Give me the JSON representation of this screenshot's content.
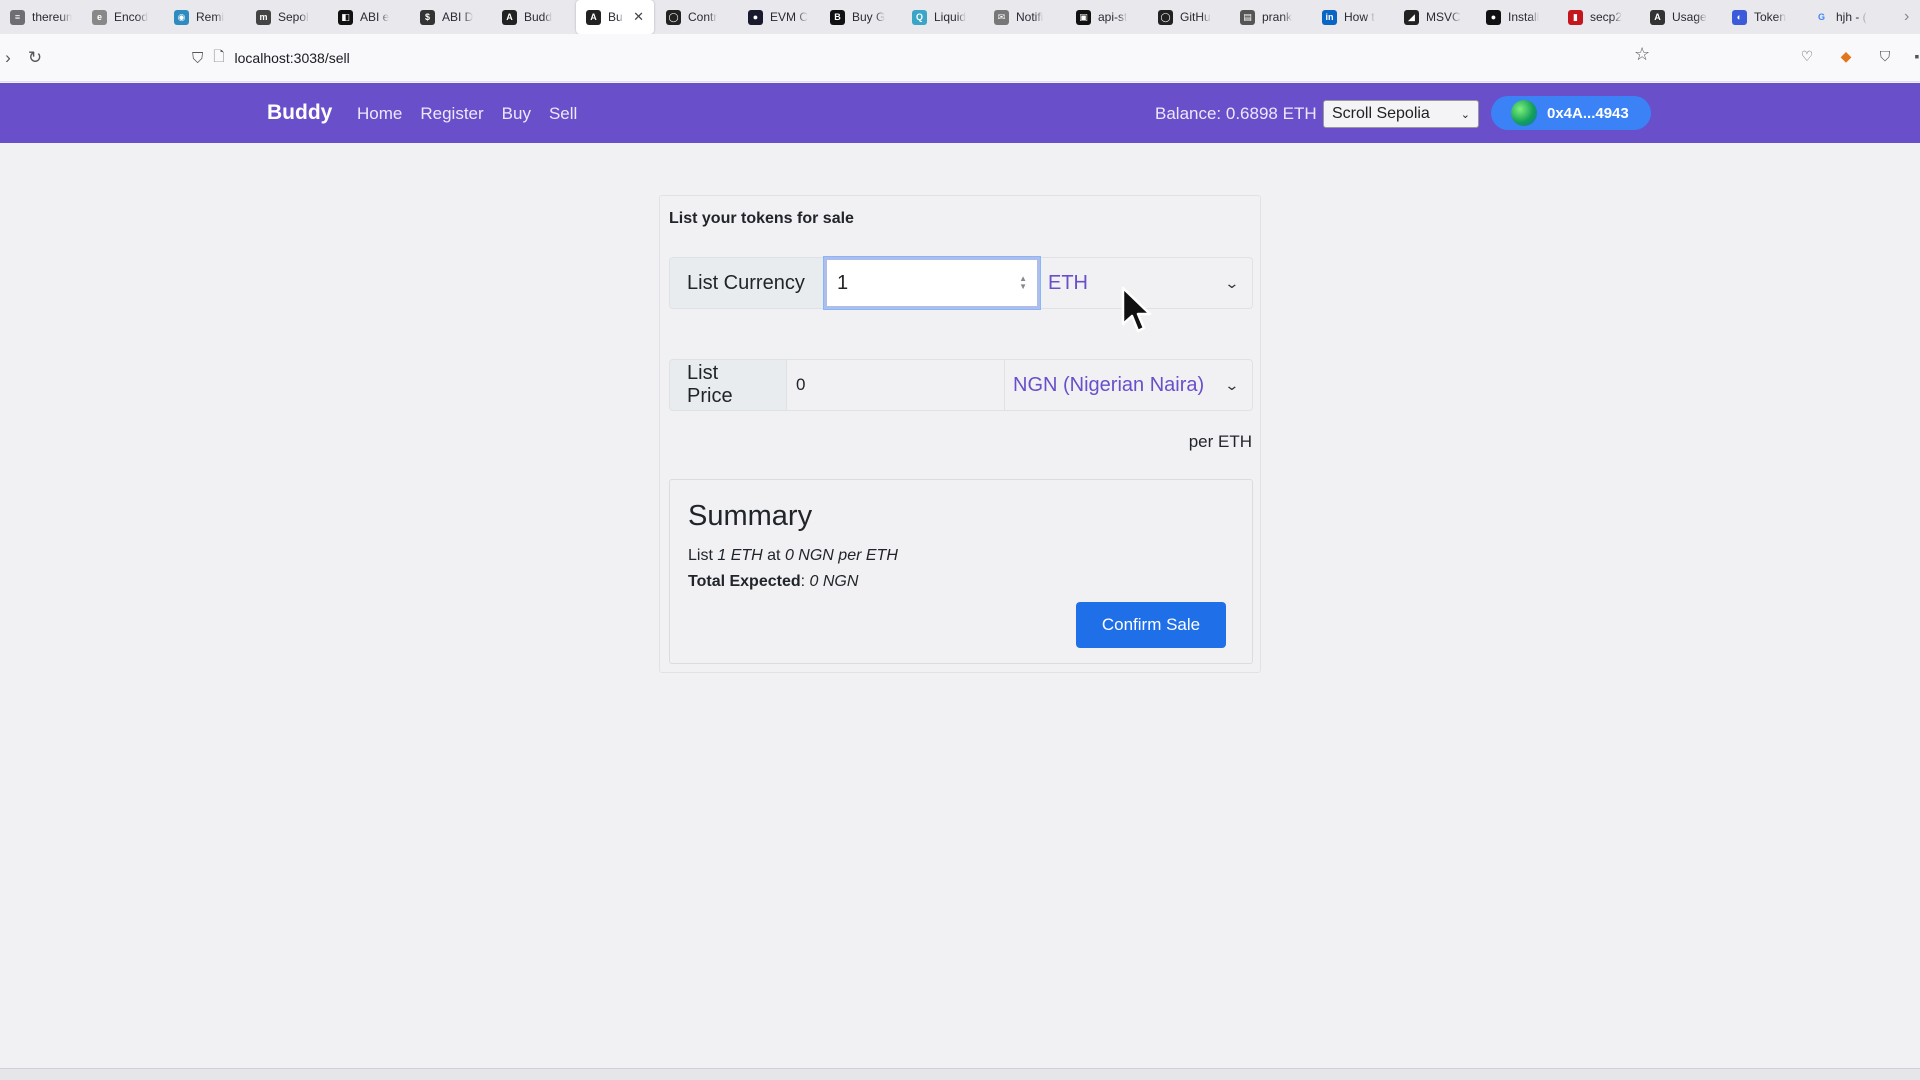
{
  "browser": {
    "tabs": [
      {
        "title": "thereum",
        "color": "#6e6e73",
        "glyph": "≡"
      },
      {
        "title": "Encod",
        "color": "#888888",
        "glyph": "e"
      },
      {
        "title": "Remi",
        "color": "#2e8bc0",
        "glyph": "◉"
      },
      {
        "title": "Sepol",
        "color": "#444444",
        "glyph": "m"
      },
      {
        "title": "ABI e",
        "color": "#111111",
        "glyph": "◧"
      },
      {
        "title": "ABI D",
        "color": "#333333",
        "glyph": "$"
      },
      {
        "title": "Budd",
        "color": "#222222",
        "glyph": "A"
      },
      {
        "title": "Bu",
        "color": "#222222",
        "glyph": "A",
        "active": true
      },
      {
        "title": "Contr",
        "color": "#222222",
        "glyph": "◯"
      },
      {
        "title": "EVM C",
        "color": "#1a1a2e",
        "glyph": "●"
      },
      {
        "title": "Buy G",
        "color": "#111111",
        "glyph": "B"
      },
      {
        "title": "Liquid",
        "color": "#3aa6c7",
        "glyph": "Q"
      },
      {
        "title": "Notifi",
        "color": "#777777",
        "glyph": "✉"
      },
      {
        "title": "api-st",
        "color": "#111111",
        "glyph": "▣"
      },
      {
        "title": "GitHu",
        "color": "#222222",
        "glyph": "◯"
      },
      {
        "title": "prank",
        "color": "#555555",
        "glyph": "▤"
      },
      {
        "title": "How t",
        "color": "#0a66c2",
        "glyph": "in"
      },
      {
        "title": "MSVC",
        "color": "#222222",
        "glyph": "◢"
      },
      {
        "title": "Install",
        "color": "#111111",
        "glyph": "●"
      },
      {
        "title": "secp2",
        "color": "#c4161c",
        "glyph": "▮"
      },
      {
        "title": "Usage",
        "color": "#333333",
        "glyph": "A"
      },
      {
        "title": "Token",
        "color": "#3b5bdb",
        "glyph": "◐"
      },
      {
        "title": "hjh - (",
        "color": "#ffffff",
        "glyph": "G"
      }
    ],
    "active_tab_close": "✕",
    "url": "localhost:3038/sell"
  },
  "navbar": {
    "brand": "Buddy",
    "links": [
      "Home",
      "Register",
      "Buy",
      "Sell"
    ],
    "balance": "Balance: 0.6898 ETH",
    "network": "Scroll Sepolia",
    "wallet": "0x4A...4943"
  },
  "sell_form": {
    "title": "List your tokens for sale",
    "currency_label": "List Currency",
    "amount_value": "1",
    "currency_selected": "ETH",
    "price_label": "List Price",
    "price_value": "0",
    "fiat_selected": "NGN (Nigerian Naira)",
    "per_unit": "per ETH"
  },
  "summary": {
    "heading": "Summary",
    "line_prefix": "List",
    "amount": "1 ETH",
    "at": "at",
    "price": "0 NGN per ETH",
    "total_label": "Total Expected",
    "total_value": "0 NGN",
    "confirm_label": "Confirm Sale"
  },
  "colors": {
    "navbar": "#6a4fcb",
    "accent": "#1f6fe8",
    "wallet": "#3b82f6"
  }
}
